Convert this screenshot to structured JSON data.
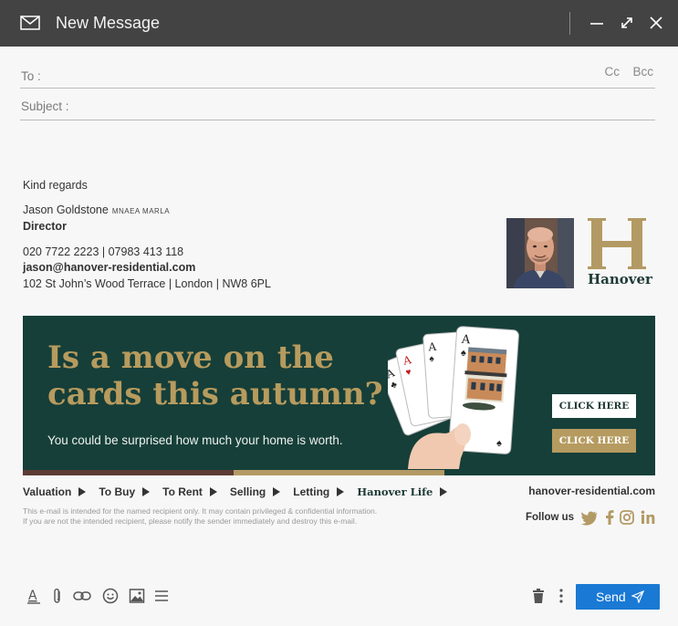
{
  "window": {
    "title": "New Message",
    "icons": [
      "mail-icon",
      "minimize-icon",
      "expand-icon",
      "close-icon"
    ]
  },
  "compose": {
    "to_label": "To :",
    "to_value": "",
    "cc_label": "Cc",
    "bcc_label": "Bcc",
    "subject_label": "Subject :",
    "subject_value": ""
  },
  "signature": {
    "closing": "Kind regards",
    "name": "Jason Goldstone",
    "credentials": "MNAEA MARLA",
    "role": "Director",
    "phones": "020 7722 2223  |  07983 413 118",
    "email": "jason@hanover-residential.com",
    "address": "102 St John’s Wood Terrace  |  London  |  NW8 6PL",
    "logo_text": "Hanover",
    "logo_letter": "H"
  },
  "banner": {
    "headline_line1": "Is a move on the",
    "headline_line2": "cards this autumn?",
    "subtext": "You could be surprised how much your home is worth.",
    "button1": "CLICK HERE",
    "button2": "CLICK HERE"
  },
  "footer": {
    "nav": [
      "Valuation",
      "To Buy",
      "To Rent",
      "Selling",
      "Letting"
    ],
    "nav_brand": "Hanover Life",
    "website": "hanover-residential.com",
    "disclaimer_line1": "This e-mail is intended for the named recipient only. It may contain privileged & confidential information.",
    "disclaimer_line2": "If you are not the intended recipient, please notify the sender immediately and destroy this e-mail.",
    "follow_label": "Follow us",
    "social_icons": [
      "twitter-icon",
      "facebook-icon",
      "instagram-icon",
      "linkedin-icon"
    ]
  },
  "toolbar": {
    "send_label": "Send",
    "icons": [
      "format-text-icon",
      "attach-icon",
      "link-icon",
      "emoji-icon",
      "image-icon",
      "more-format-icon",
      "trash-icon",
      "more-options-icon"
    ]
  },
  "colors": {
    "titlebar": "#434343",
    "banner_bg": "#163f39",
    "gold": "#b69b60",
    "send": "#1a79d4"
  }
}
